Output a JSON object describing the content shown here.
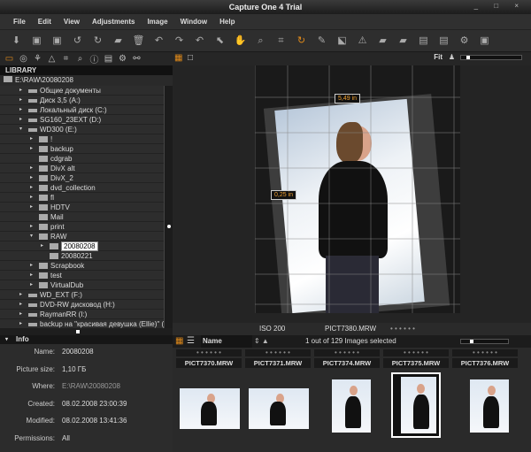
{
  "title": "Capture One 4 Trial",
  "window_controls": "_ □ ×",
  "menu": [
    "File",
    "Edit",
    "View",
    "Adjustments",
    "Image",
    "Window",
    "Help"
  ],
  "toolbar_icons": [
    "import",
    "capture",
    "compare",
    "rotate-left",
    "rotate-right",
    "new-folder",
    "delete",
    "undo",
    "redo",
    "reset",
    "select",
    "pan",
    "zoom",
    "crop",
    "straighten",
    "picker",
    "keystone",
    "warning",
    "export",
    "process",
    "batch",
    "batch2",
    "settings",
    "info"
  ],
  "library": {
    "header": "LIBRARY",
    "path": "E:\\RAW\\20080208",
    "tree": [
      {
        "label": "Общие документы",
        "indent": 2,
        "arrow": "▸",
        "icon": "drive"
      },
      {
        "label": "Диск 3,5 (A:)",
        "indent": 2,
        "arrow": "▸",
        "icon": "drive"
      },
      {
        "label": "Локальный диск (C:)",
        "indent": 2,
        "arrow": "▸",
        "icon": "drive"
      },
      {
        "label": "SG160_23EXT (D:)",
        "indent": 2,
        "arrow": "▸",
        "icon": "drive"
      },
      {
        "label": "WD300 (E:)",
        "indent": 2,
        "arrow": "▾",
        "icon": "drive"
      },
      {
        "label": "!",
        "indent": 3,
        "arrow": "▸",
        "icon": "folder"
      },
      {
        "label": "backup",
        "indent": 3,
        "arrow": "▸",
        "icon": "folder"
      },
      {
        "label": "cdgrab",
        "indent": 3,
        "arrow": "",
        "icon": "folder"
      },
      {
        "label": "DivX alt",
        "indent": 3,
        "arrow": "▸",
        "icon": "folder"
      },
      {
        "label": "DivX_2",
        "indent": 3,
        "arrow": "▸",
        "icon": "folder"
      },
      {
        "label": "dvd_collection",
        "indent": 3,
        "arrow": "▸",
        "icon": "folder"
      },
      {
        "label": "fl",
        "indent": 3,
        "arrow": "▸",
        "icon": "folder"
      },
      {
        "label": "HDTV",
        "indent": 3,
        "arrow": "▸",
        "icon": "folder"
      },
      {
        "label": "Mail",
        "indent": 3,
        "arrow": "",
        "icon": "folder"
      },
      {
        "label": "print",
        "indent": 3,
        "arrow": "▸",
        "icon": "folder"
      },
      {
        "label": "RAW",
        "indent": 3,
        "arrow": "▾",
        "icon": "folder"
      },
      {
        "label": "20080208",
        "indent": 4,
        "arrow": "▸",
        "icon": "folder",
        "selected": true
      },
      {
        "label": "20080221",
        "indent": 4,
        "arrow": "",
        "icon": "folder"
      },
      {
        "label": "Scrapbook",
        "indent": 3,
        "arrow": "▸",
        "icon": "folder"
      },
      {
        "label": "test",
        "indent": 3,
        "arrow": "▸",
        "icon": "folder"
      },
      {
        "label": "VirtualDub",
        "indent": 3,
        "arrow": "▸",
        "icon": "folder"
      },
      {
        "label": "WD_EXT (F:)",
        "indent": 2,
        "arrow": "▸",
        "icon": "drive"
      },
      {
        "label": "DVD-RW дисковод (H:)",
        "indent": 2,
        "arrow": "▸",
        "icon": "drive"
      },
      {
        "label": "RaymanRR (I:)",
        "indent": 2,
        "arrow": "▸",
        "icon": "drive"
      },
      {
        "label": "backup на \"красивая девушка (Ellie)\" (",
        "indent": 2,
        "arrow": "▸",
        "icon": "drive"
      }
    ]
  },
  "info": {
    "header": "Info",
    "rows": [
      {
        "k": "Name:",
        "v": "20080208"
      },
      {
        "k": "Picture size:",
        "v": "1,10 ГБ"
      },
      {
        "k": "Where:",
        "v": "E:\\RAW\\20080208"
      },
      {
        "k": "Created:",
        "v": "08.02.2008 23:00:39"
      },
      {
        "k": "Modified:",
        "v": "08.02.2008 13:41:36"
      },
      {
        "k": "Permissions:",
        "v": "All"
      }
    ]
  },
  "viewer": {
    "fit": "Fit",
    "measure_top": "5,49 in",
    "measure_left": "0,25 in",
    "iso": "ISO 200",
    "filename": "PICT7380.MRW",
    "rating": "• • • • • •"
  },
  "browser": {
    "sort": "Name",
    "count": "1 out of 129 Images selected",
    "thumbs": [
      {
        "name": "PICT7370.MRW"
      },
      {
        "name": "PICT7371.MRW"
      },
      {
        "name": "PICT7374.MRW"
      },
      {
        "name": "PICT7375.MRW",
        "selected": true
      },
      {
        "name": "PICT7376.MRW"
      }
    ],
    "rating": "• • • • • •"
  },
  "colors": {
    "accent": "#e08a1a",
    "bg": "#2b2b2b"
  }
}
